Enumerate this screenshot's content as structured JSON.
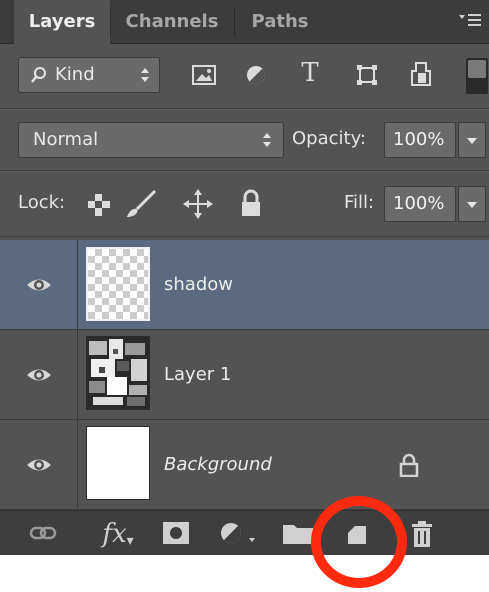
{
  "tabs": [
    {
      "label": "Layers",
      "active": true
    },
    {
      "label": "Channels",
      "active": false
    },
    {
      "label": "Paths",
      "active": false
    }
  ],
  "filter": {
    "kind_label": "Kind",
    "icons": [
      "image-filter-icon",
      "adjustment-filter-icon",
      "type-filter-icon",
      "shape-filter-icon",
      "smart-object-filter-icon"
    ]
  },
  "blend": {
    "mode": "Normal",
    "opacity_label": "Opacity:",
    "opacity_value": "100%"
  },
  "lock": {
    "label": "Lock:",
    "fill_label": "Fill:",
    "fill_value": "100%"
  },
  "layers": [
    {
      "name": "shadow",
      "selected": true,
      "italic": false,
      "thumb": "transparent",
      "locked": false
    },
    {
      "name": "Layer 1",
      "selected": false,
      "italic": false,
      "thumb": "photo",
      "locked": false
    },
    {
      "name": "Background",
      "selected": false,
      "italic": true,
      "thumb": "white",
      "locked": true
    }
  ],
  "bottom_bar": {
    "fx_label": "fx",
    "highlight_color": "#ff2a10"
  },
  "colors": {
    "panel": "#535353",
    "selected_layer": "#5a6a80",
    "tab_bar": "#3c3c3c"
  }
}
